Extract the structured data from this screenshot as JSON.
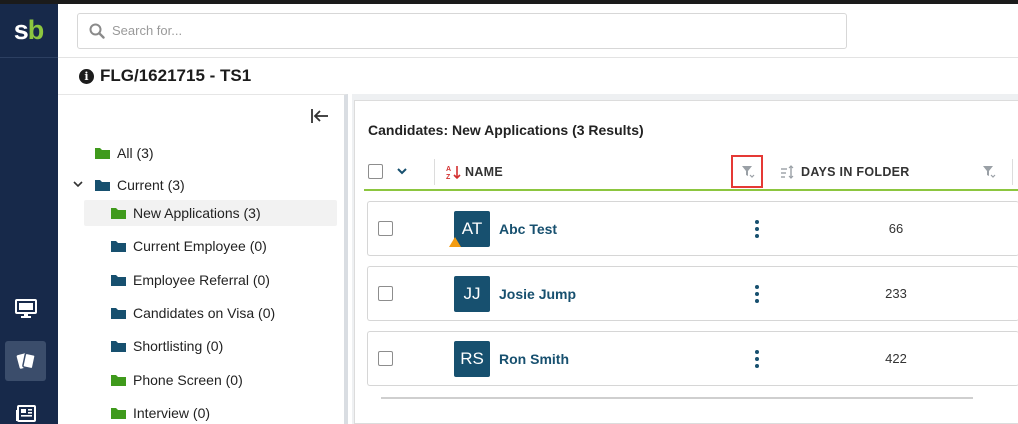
{
  "app": {
    "logo_s": "s",
    "logo_b": "b",
    "brand_colors": {
      "navy": "#17294a",
      "green": "#8cc63f",
      "teal": "#17506f",
      "alert": "#e53935"
    }
  },
  "rail": {
    "items": [
      {
        "icon": "monitor-icon",
        "active": false
      },
      {
        "icon": "cards-icon",
        "active": true
      },
      {
        "icon": "news-icon",
        "active": false
      }
    ]
  },
  "search": {
    "placeholder": "Search for...",
    "value": ""
  },
  "breadcrumb": {
    "title": "FLG/1621715 - TS1"
  },
  "tree": {
    "items": [
      {
        "label": "All (3)",
        "color": "green"
      },
      {
        "label": "Current (3)",
        "color": "navy",
        "expanded": true
      },
      {
        "label": "New Applications (3)",
        "color": "green",
        "selected": true
      },
      {
        "label": "Current Employee (0)",
        "color": "navy"
      },
      {
        "label": "Employee Referral (0)",
        "color": "navy"
      },
      {
        "label": "Candidates on Visa (0)",
        "color": "navy"
      },
      {
        "label": "Shortlisting (0)",
        "color": "navy"
      },
      {
        "label": "Phone Screen (0)",
        "color": "green"
      },
      {
        "label": "Interview (0)",
        "color": "green"
      }
    ]
  },
  "list": {
    "results_label": "Candidates: New Applications (3 Results)",
    "columns": {
      "name": "NAME",
      "days": "DAYS IN FOLDER"
    },
    "rows": [
      {
        "initials": "AT",
        "name": "Abc Test",
        "days": "66",
        "warning": true
      },
      {
        "initials": "JJ",
        "name": "Josie Jump",
        "days": "233",
        "warning": false
      },
      {
        "initials": "RS",
        "name": "Ron Smith",
        "days": "422",
        "warning": false
      }
    ]
  }
}
